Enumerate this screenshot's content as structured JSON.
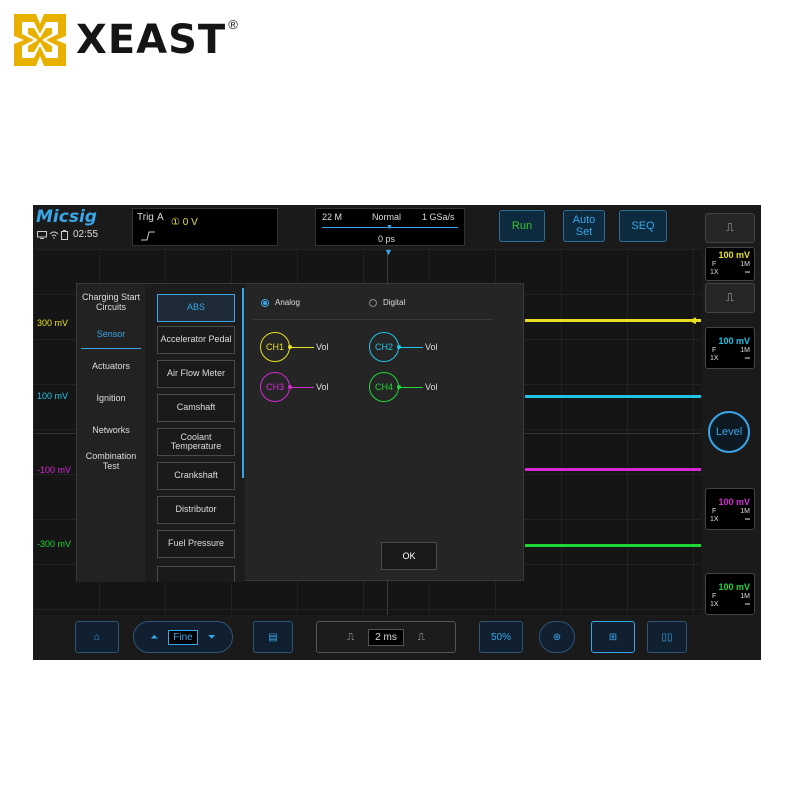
{
  "brand_logo": {
    "text": "XEAST",
    "registered": "®",
    "mark_color": "#e8b100"
  },
  "device": {
    "brand": "Micsig",
    "time": "02:55",
    "status_icons": [
      "monitor-icon",
      "wifi-icon",
      "battery-icon"
    ],
    "trigger": {
      "label": "Trig",
      "source": "A",
      "channel_marker": "①",
      "value": "0 V",
      "edge": "rising"
    },
    "timebase": {
      "memory": "22 M",
      "mode": "Normal",
      "rate": "1 GSa/s",
      "delay": "0 ps"
    },
    "buttons": {
      "run": "Run",
      "auto_set": "Auto Set",
      "seq": "SEQ"
    },
    "level_labels": [
      "300 mV",
      "100 mV",
      "-100 mV",
      "-300 mV"
    ],
    "colors": {
      "ch1": "#e8e020",
      "ch2": "#1fc4e8",
      "ch3": "#d62ad6",
      "ch4": "#1fd636",
      "accent": "#3aa6e8"
    },
    "channel_cards": [
      {
        "volts": "100 mV",
        "coupling": "F",
        "impedance": "1M",
        "probe": "1X"
      },
      {
        "volts": "100 mV",
        "coupling": "F",
        "impedance": "1M",
        "probe": "1X"
      },
      {
        "volts": "100 mV",
        "coupling": "F",
        "impedance": "1M",
        "probe": "1X"
      },
      {
        "volts": "100 mV",
        "coupling": "F",
        "impedance": "1M",
        "probe": "1X"
      }
    ],
    "level_button": "Level",
    "bottom_bar": {
      "fine": "Fine",
      "time_per_div": "2 ms",
      "zoom": "50%"
    }
  },
  "dialog": {
    "categories": [
      "Charging Start Circuits",
      "Sensor",
      "Actuators",
      "Ignition",
      "Networks",
      "Combination Test"
    ],
    "active_category": "Sensor",
    "sensors": [
      "ABS",
      "Accelerator Pedal",
      "Air Flow Meter",
      "Camshaft",
      "Coolant Temperature",
      "Crankshaft",
      "Distributor",
      "Fuel Pressure"
    ],
    "active_sensor": "ABS",
    "modes": {
      "analog": "Analog",
      "digital": "Digital",
      "selected": "Analog"
    },
    "channels": [
      {
        "name": "CH1",
        "signal": "Vol"
      },
      {
        "name": "CH2",
        "signal": "Vol"
      },
      {
        "name": "CH3",
        "signal": "Vol"
      },
      {
        "name": "CH4",
        "signal": "Vol"
      }
    ],
    "ok": "OK"
  }
}
